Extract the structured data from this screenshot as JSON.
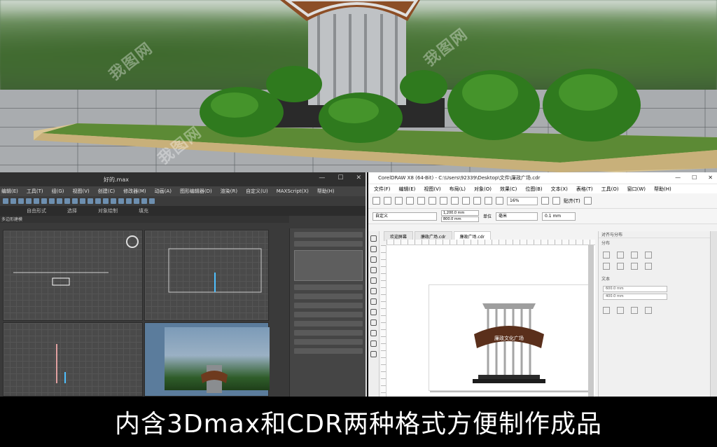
{
  "render": {
    "watermarks": [
      "我图网",
      "我图网",
      "我图网"
    ]
  },
  "max": {
    "title": "好的.max",
    "window_controls": [
      "—",
      "☐",
      "✕"
    ],
    "menu": [
      "编辑(E)",
      "工具(T)",
      "组(G)",
      "视图(V)",
      "创建(C)",
      "修改器(M)",
      "动画(A)",
      "图形编辑器(D)",
      "渲染(R)",
      "自定义(U)",
      "MAXScript(X)",
      "帮助(H)"
    ],
    "ribbon": [
      "自由形式",
      "选择",
      "对象绘制",
      "填充"
    ],
    "ribbon_left": "多边形建模"
  },
  "cdr": {
    "title": "CorelDRAW X8 (64-Bit) - C:\\Users\\92339\\Desktop\\文件\\廉政广场.cdr",
    "window_controls": [
      "—",
      "☐",
      "✕"
    ],
    "menu": [
      "文件(F)",
      "编辑(E)",
      "视图(V)",
      "布局(L)",
      "对象(O)",
      "效果(C)",
      "位图(B)",
      "文本(X)",
      "表格(T)",
      "工具(O)",
      "窗口(W)",
      "帮助(H)"
    ],
    "zoom": "16%",
    "snap_label": "贴齐(T)",
    "preset": "自定义",
    "width": "1,200.0 mm",
    "height": "800.0 mm",
    "unit_label": "单位",
    "unit": "毫米",
    "nudge": "0.1 mm",
    "tabs": [
      "欢迎屏幕",
      "廉政广场.cdr",
      "廉政广场.cdr"
    ],
    "docker_title": "对齐与分布",
    "docker_section": "分布",
    "docker_text": "文本",
    "x_value": "600.0 mm",
    "y_value": "400.0 mm",
    "sign_text": "廉政文化广场"
  },
  "caption": "内含3Dmax和CDR两种格式方便制作成品"
}
